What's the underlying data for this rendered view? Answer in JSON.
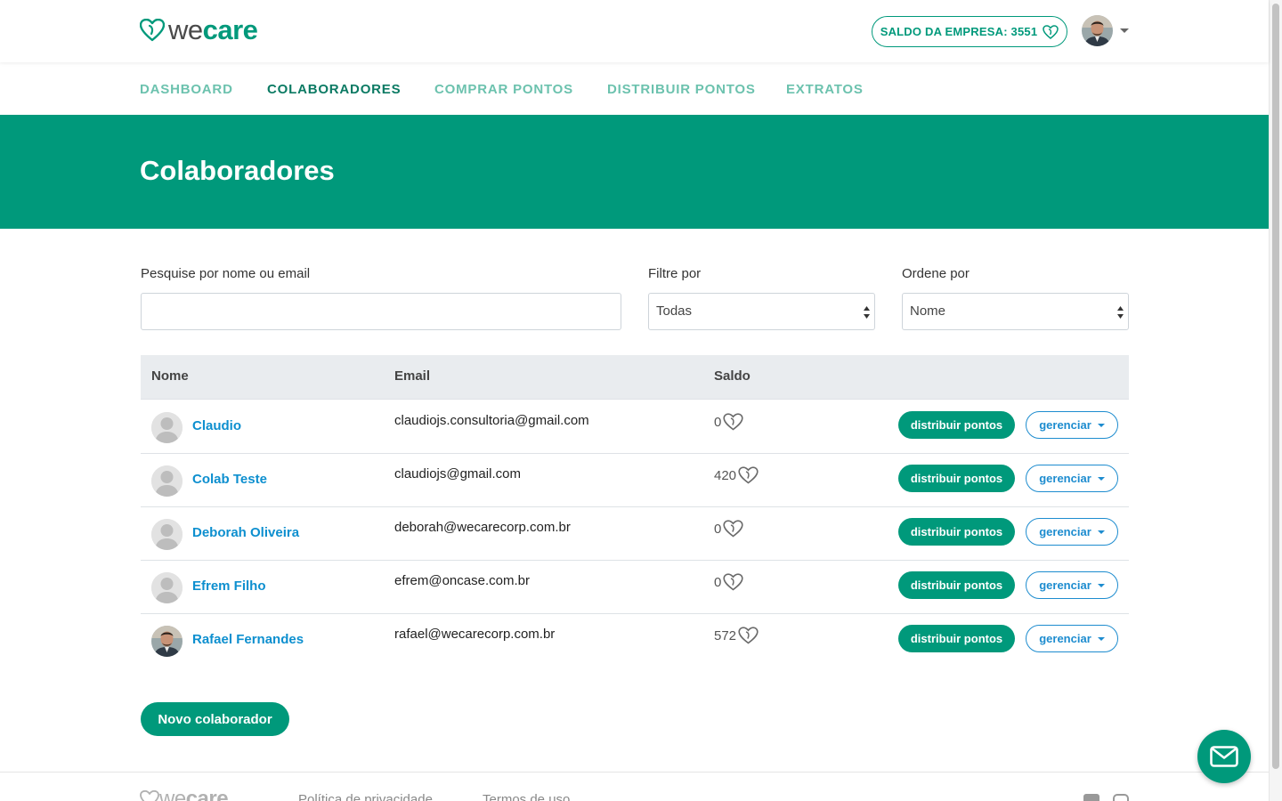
{
  "header": {
    "logo_we": "we",
    "logo_care": "care",
    "saldo_label": "SALDO DA EMPRESA: 3551"
  },
  "nav": {
    "items": [
      {
        "label": "DASHBOARD"
      },
      {
        "label": "COLABORADORES"
      },
      {
        "label": "COMPRAR PONTOS"
      },
      {
        "label": "DISTRIBUIR PONTOS"
      },
      {
        "label": "EXTRATOS"
      }
    ],
    "active": "COLABORADORES"
  },
  "page": {
    "title": "Colaboradores"
  },
  "filters": {
    "search_label": "Pesquise por nome ou email",
    "search_value": "",
    "filter_label": "Filtre por",
    "filter_value": "Todas",
    "order_label": "Ordene por",
    "order_value": "Nome"
  },
  "table": {
    "headers": [
      "Nome",
      "Email",
      "Saldo"
    ],
    "rows": [
      {
        "name": "Claudio",
        "email": "claudiojs.consultoria@gmail.com",
        "saldo": "0",
        "photo": false
      },
      {
        "name": "Colab Teste",
        "email": "claudiojs@gmail.com",
        "saldo": "420",
        "photo": false
      },
      {
        "name": "Deborah Oliveira",
        "email": "deborah@wecarecorp.com.br",
        "saldo": "0",
        "photo": false
      },
      {
        "name": "Efrem Filho",
        "email": "efrem@oncase.com.br",
        "saldo": "0",
        "photo": false
      },
      {
        "name": "Rafael Fernandes",
        "email": "rafael@wecarecorp.com.br",
        "saldo": "572",
        "photo": true
      }
    ],
    "btn_distribuir": "distribuir pontos",
    "btn_gerenciar": "gerenciar"
  },
  "actions": {
    "novo_label": "Novo colaborador"
  },
  "footer": {
    "logo_we": "we",
    "logo_care": "care",
    "links": [
      "Política de privacidade",
      "Termos de uso"
    ]
  },
  "colors": {
    "brand_green": "#00997b",
    "nav_inactive": "#6cc2ae",
    "nav_active": "#0b7a63",
    "link_blue": "#0d8fcf"
  },
  "icons": {
    "heart_coin": "heart-coin-icon",
    "mail": "mail-icon",
    "facebook": "facebook-icon",
    "instagram": "instagram-icon"
  }
}
